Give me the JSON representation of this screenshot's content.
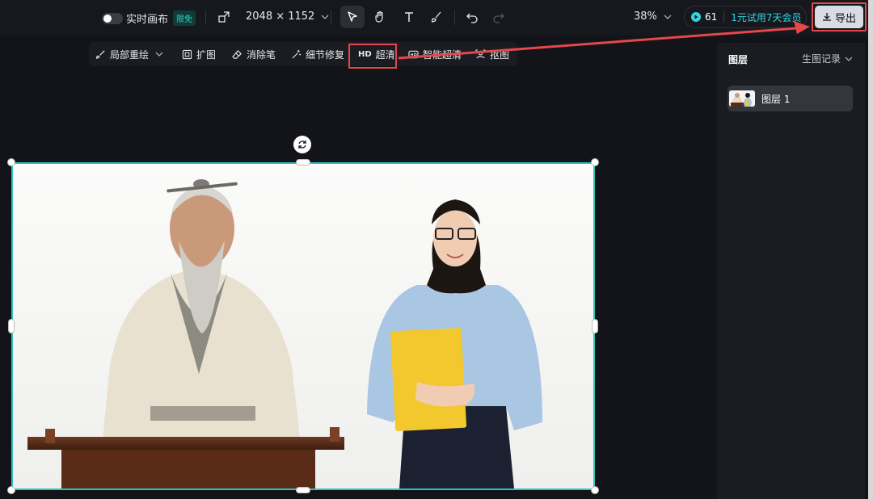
{
  "topbar": {
    "realtime_label": "实时画布",
    "realtime_badge": "限免",
    "canvas_size": "2048 × 1152",
    "zoom": "38%",
    "credits_value": "61",
    "trial_text": "1元试用7天会员",
    "export_label": "导出"
  },
  "tools": [
    {
      "label": "局部重绘",
      "icon": "brush-icon"
    },
    {
      "label": "扩图",
      "icon": "expand-icon"
    },
    {
      "label": "消除笔",
      "icon": "eraser-icon"
    },
    {
      "label": "细节修复",
      "icon": "magic-wand-icon"
    },
    {
      "label": "超清",
      "prefix": "HD"
    },
    {
      "label": "智能超清",
      "icon": "hd-box-icon"
    },
    {
      "label": "抠图",
      "icon": "cutout-icon"
    }
  ],
  "panel": {
    "title": "图层",
    "history_label": "生图记录",
    "layers": [
      {
        "name": "图层 1"
      }
    ]
  },
  "colors": {
    "accent": "#2fc4bd",
    "highlight": "#e5474b",
    "background": "#131419"
  }
}
